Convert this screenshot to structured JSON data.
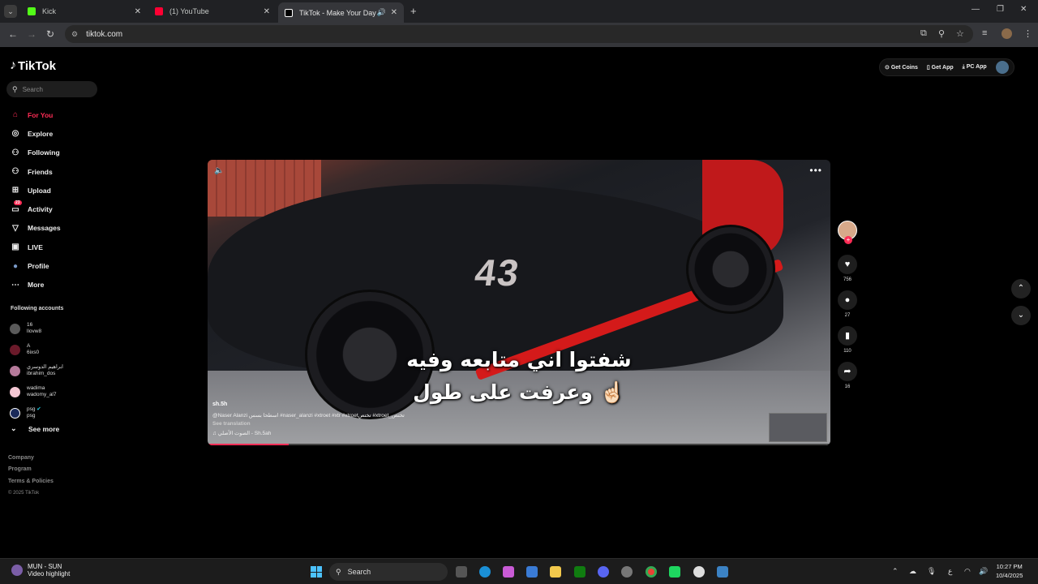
{
  "browser": {
    "tabs": [
      {
        "title": "Kick",
        "color": "#53fc18"
      },
      {
        "title": "(1) YouTube",
        "color": "#ff0033"
      },
      {
        "title": "TikTok - Make Your Day",
        "color": "#ffffff"
      }
    ],
    "url": "tiktok.com"
  },
  "tiktok": {
    "logo": "TikTok",
    "search_placeholder": "Search",
    "nav": [
      {
        "label": "For You",
        "icon": "home-icon",
        "glyph": "⌂"
      },
      {
        "label": "Explore",
        "icon": "compass-icon",
        "glyph": "◎"
      },
      {
        "label": "Following",
        "icon": "following-icon",
        "glyph": "⚇"
      },
      {
        "label": "Friends",
        "icon": "friends-icon",
        "glyph": "⚇"
      },
      {
        "label": "Upload",
        "icon": "upload-icon",
        "glyph": "⊞"
      },
      {
        "label": "Activity",
        "icon": "activity-icon",
        "glyph": "▭",
        "badge": "23"
      },
      {
        "label": "Messages",
        "icon": "messages-icon",
        "glyph": "▽"
      },
      {
        "label": "LIVE",
        "icon": "live-icon",
        "glyph": "▣"
      },
      {
        "label": "Profile",
        "icon": "profile-avatar-icon",
        "glyph": "●"
      },
      {
        "label": "More",
        "icon": "more-icon",
        "glyph": "⋯"
      }
    ],
    "following_title": "Following accounts",
    "following": [
      {
        "name": "16",
        "handle": "llovw8",
        "color": "#5a5a5a"
      },
      {
        "name": "A",
        "handle": "6ixs0",
        "color": "#6b1a2a"
      },
      {
        "name": "ابراهيم الدوسري",
        "handle": "ibrahim_dos",
        "color": "#b57a9a"
      },
      {
        "name": "wadima",
        "handle": "wadomy_al7",
        "color": "#f4c7d4"
      },
      {
        "name": "psg",
        "handle": "psg",
        "color": "#1a2a5a"
      }
    ],
    "see_more": "See more",
    "footer": [
      "Company",
      "Program",
      "Terms & Policies"
    ],
    "copyright": "© 2025 TikTok",
    "header_buttons": [
      "Get Coins",
      "Get App",
      "PC App"
    ]
  },
  "video": {
    "caption_line1": "شفتوا اني متابعه وفيه",
    "caption_line2": "وعرفت على طول ☝🏻",
    "car_number": "43",
    "author": "sh.5h",
    "description": "@Naser Alanzi اسطحا بسس  #naser_alanzi  #xtroet  #xtr  #xtroetتختص  #xtroet_تختص",
    "see_translation": "See translation",
    "sound": "♫ الصوت الأصلي - Sh.5ah",
    "progress": 0.13,
    "likes": "756",
    "comments": "27",
    "saves": "110",
    "shares": "16"
  },
  "taskbar": {
    "weather_title": "MUN - SUN",
    "weather_sub": "Video highlight",
    "search": "Search",
    "lang": "ع",
    "time": "10:27 PM",
    "date": "10/4/2025"
  }
}
